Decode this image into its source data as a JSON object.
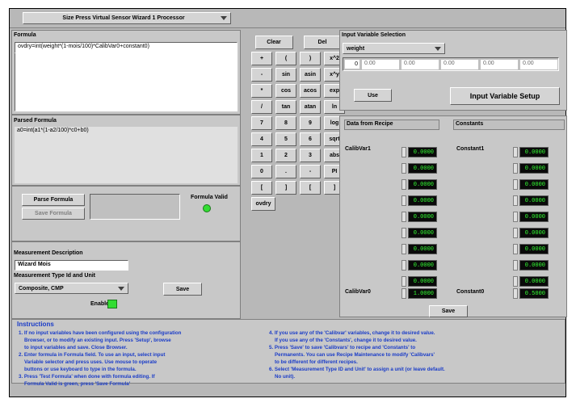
{
  "header": {
    "processor_select": "Size Press Virtual Sensor Wizard 1 Processor"
  },
  "formula": {
    "label": "Formula",
    "value": "ovdry=int(weight*(1-mois/100)*CalibVar0+constant0)"
  },
  "parsed": {
    "label": "Parsed Formula",
    "value": "a0=int(a1*(1-a2/100)*c0+b0)"
  },
  "parse_section": {
    "parse_button": "Parse Formula",
    "save_button": "Save Formula",
    "valid_label": "Formula Valid"
  },
  "keypad": {
    "rows": [
      [
        "Clear",
        "",
        "Del",
        ""
      ],
      [
        "+",
        "(",
        ")",
        "x^2"
      ],
      [
        "-",
        "sin",
        "asin",
        "x^y"
      ],
      [
        "*",
        "cos",
        "acos",
        "exp"
      ],
      [
        "/",
        "tan",
        "atan",
        "ln"
      ],
      [
        "7",
        "8",
        "9",
        "log"
      ],
      [
        "4",
        "5",
        "6",
        "sqrt"
      ],
      [
        "1",
        "2",
        "3",
        "abs"
      ],
      [
        "0",
        ".",
        "-",
        "PI"
      ],
      [
        "[",
        "]",
        "[",
        "]"
      ],
      [
        "ovdry",
        "",
        "",
        ""
      ]
    ]
  },
  "measurement": {
    "desc_label": "Measurement Description",
    "desc_value": "Wizard Mois",
    "type_label": "Measurement Type Id and Unit",
    "type_value": "Composite, CMP",
    "save_button": "Save",
    "enable_label": "Enable"
  },
  "input_var": {
    "label": "Input Variable Selection",
    "select_value": "weight",
    "index": "0",
    "values": [
      "0.00",
      "0.00",
      "0.00",
      "0.00",
      "0.00"
    ],
    "use_button": "Use",
    "setup_button": "Input Variable Setup"
  },
  "recipe": {
    "data_label": "Data from Recipe",
    "constants_label": "Constants",
    "calib_top": "CalibVar1",
    "calib_bottom": "CalibVar0",
    "const_top": "Constant1",
    "const_bottom": "Constant0",
    "calib_values": [
      "0.0000",
      "0.0000",
      "0.0000",
      "0.0000",
      "0.0000",
      "0.0000",
      "0.0000",
      "0.0000",
      "0.0000",
      "1.0000"
    ],
    "const_values": [
      "0.0000",
      "0.0000",
      "0.0000",
      "0.0000",
      "0.0000",
      "0.0000",
      "0.0000",
      "0.0000",
      "0.0000",
      "0.5000"
    ],
    "save_button": "Save"
  },
  "instructions": {
    "title": "Instructions",
    "left": [
      "1. If no input variables have been configured using the configuration",
      "   Browser, or to modify an existing input. Press 'Setup', browse",
      "   to input variables and save. Close Browser.",
      "2. Enter formula in Formula field. To use an input, select input",
      "   Variable selector and press uses. Use mouse to operate",
      "   buttons or use keyboard to type in the formula.",
      "3. Press 'Test Formula' when done with formula editing. If",
      "   Formula Valid is green, press 'Save Formula'"
    ],
    "right": [
      "4. If you use any of the 'Calibvar' variables, change it to desired value.",
      "   If you use any of the 'Constants', change it to desired value.",
      "5. Press 'Save' to save 'Calibvars' to recipe and 'Constants' to",
      "   Permanents. You can use Recipe Maintenance to modify 'Calibvars'",
      "   to be different for different recipes.",
      "6. Select 'Measurement Type ID and Unit' to assign a unit (or leave default.",
      "   No unit)."
    ]
  }
}
